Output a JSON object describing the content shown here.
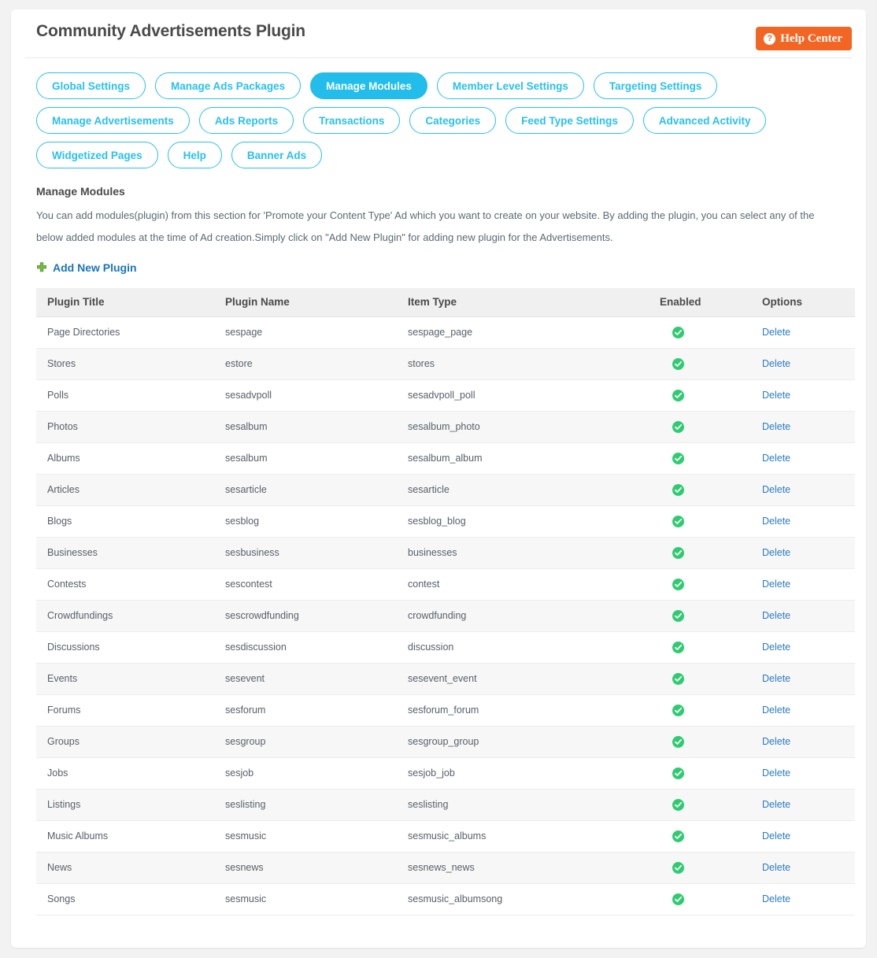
{
  "header": {
    "title": "Community Advertisements Plugin",
    "help_button": {
      "label": "Help Center",
      "icon": "question-circle-icon",
      "glyph": "?",
      "color": "#f26522"
    }
  },
  "tabs": [
    {
      "label": "Global Settings",
      "active": false
    },
    {
      "label": "Manage Ads Packages",
      "active": false
    },
    {
      "label": "Manage Modules",
      "active": true
    },
    {
      "label": "Member Level Settings",
      "active": false
    },
    {
      "label": "Targeting Settings",
      "active": false
    },
    {
      "label": "Manage Advertisements",
      "active": false
    },
    {
      "label": "Ads Reports",
      "active": false
    },
    {
      "label": "Transactions",
      "active": false
    },
    {
      "label": "Categories",
      "active": false
    },
    {
      "label": "Feed Type Settings",
      "active": false
    },
    {
      "label": "Advanced Activity",
      "active": false
    },
    {
      "label": "Widgetized Pages",
      "active": false
    },
    {
      "label": "Help",
      "active": false
    },
    {
      "label": "Banner Ads",
      "active": false
    }
  ],
  "section": {
    "heading": "Manage Modules",
    "description": "You can add modules(plugin) from this section for 'Promote your Content Type' Ad which you want to create on your website. By adding the plugin, you can select any of the below added modules at the time of Ad creation.Simply click on \"Add New Plugin\" for adding new plugin for the Advertisements."
  },
  "add_new_plugin": {
    "label": "Add New Plugin",
    "icon": "plus-icon",
    "icon_color": "#73b942"
  },
  "table": {
    "columns": [
      "Plugin Title",
      "Plugin Name",
      "Item Type",
      "Enabled",
      "Options"
    ],
    "enabled_icon": "check-circle-icon",
    "enabled_icon_color": "#2ecc71",
    "delete_label": "Delete",
    "rows": [
      {
        "title": "Page Directories",
        "name": "sespage",
        "item_type": "sespage_page",
        "enabled": true,
        "option": "Delete"
      },
      {
        "title": "Stores",
        "name": "estore",
        "item_type": "stores",
        "enabled": true,
        "option": "Delete"
      },
      {
        "title": "Polls",
        "name": "sesadvpoll",
        "item_type": "sesadvpoll_poll",
        "enabled": true,
        "option": "Delete"
      },
      {
        "title": "Photos",
        "name": "sesalbum",
        "item_type": "sesalbum_photo",
        "enabled": true,
        "option": "Delete"
      },
      {
        "title": "Albums",
        "name": "sesalbum",
        "item_type": "sesalbum_album",
        "enabled": true,
        "option": "Delete"
      },
      {
        "title": "Articles",
        "name": "sesarticle",
        "item_type": "sesarticle",
        "enabled": true,
        "option": "Delete"
      },
      {
        "title": "Blogs",
        "name": "sesblog",
        "item_type": "sesblog_blog",
        "enabled": true,
        "option": "Delete"
      },
      {
        "title": "Businesses",
        "name": "sesbusiness",
        "item_type": "businesses",
        "enabled": true,
        "option": "Delete"
      },
      {
        "title": "Contests",
        "name": "sescontest",
        "item_type": "contest",
        "enabled": true,
        "option": "Delete"
      },
      {
        "title": "Crowdfundings",
        "name": "sescrowdfunding",
        "item_type": "crowdfunding",
        "enabled": true,
        "option": "Delete"
      },
      {
        "title": "Discussions",
        "name": "sesdiscussion",
        "item_type": "discussion",
        "enabled": true,
        "option": "Delete"
      },
      {
        "title": "Events",
        "name": "sesevent",
        "item_type": "sesevent_event",
        "enabled": true,
        "option": "Delete"
      },
      {
        "title": "Forums",
        "name": "sesforum",
        "item_type": "sesforum_forum",
        "enabled": true,
        "option": "Delete"
      },
      {
        "title": "Groups",
        "name": "sesgroup",
        "item_type": "sesgroup_group",
        "enabled": true,
        "option": "Delete"
      },
      {
        "title": "Jobs",
        "name": "sesjob",
        "item_type": "sesjob_job",
        "enabled": true,
        "option": "Delete"
      },
      {
        "title": "Listings",
        "name": "seslisting",
        "item_type": "seslisting",
        "enabled": true,
        "option": "Delete"
      },
      {
        "title": "Music Albums",
        "name": "sesmusic",
        "item_type": "sesmusic_albums",
        "enabled": true,
        "option": "Delete"
      },
      {
        "title": "News",
        "name": "sesnews",
        "item_type": "sesnews_news",
        "enabled": true,
        "option": "Delete"
      },
      {
        "title": "Songs",
        "name": "sesmusic",
        "item_type": "sesmusic_albumsong",
        "enabled": true,
        "option": "Delete"
      }
    ]
  }
}
